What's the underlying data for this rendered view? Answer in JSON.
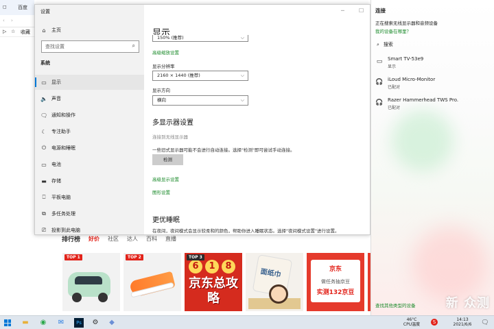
{
  "browser": {
    "tabs": [
      "百度"
    ],
    "favorites": "收藏",
    "rank_nav": {
      "title": "排行榜",
      "items": [
        "好价",
        "社区",
        "达人",
        "百科",
        "直播"
      ]
    },
    "products": [
      {
        "badge": "TOP 1"
      },
      {
        "badge": "TOP 2"
      },
      {
        "badge": "TOP 3",
        "digits": [
          "6",
          "1",
          "8"
        ],
        "promo": "京东总攻略"
      },
      {
        "tissue_text": "面纸巾"
      },
      {
        "logo": "京东",
        "line1": "做任务抽京豆",
        "line2": "实测132京豆"
      }
    ]
  },
  "settings": {
    "window_title": "设置",
    "home_label": "主页",
    "search_placeholder": "查找设置",
    "section": "系统",
    "nav_items": [
      {
        "icon": "display-icon",
        "glyph": "▭",
        "label": "显示"
      },
      {
        "icon": "sound-icon",
        "glyph": "🔈",
        "label": "声音"
      },
      {
        "icon": "notification-icon",
        "glyph": "🗨",
        "label": "通知和操作"
      },
      {
        "icon": "focus-assist-icon",
        "glyph": "☾",
        "label": "专注助手"
      },
      {
        "icon": "power-icon",
        "glyph": "⏻",
        "label": "电源和睡眠"
      },
      {
        "icon": "battery-icon",
        "glyph": "▭",
        "label": "电池"
      },
      {
        "icon": "storage-icon",
        "glyph": "▬",
        "label": "存储"
      },
      {
        "icon": "tablet-icon",
        "glyph": "⎕",
        "label": "平板电脑"
      },
      {
        "icon": "multitasking-icon",
        "glyph": "⧉",
        "label": "多任务处理"
      },
      {
        "icon": "projecting-icon",
        "glyph": "⎚",
        "label": "投影到此电脑"
      }
    ],
    "display": {
      "title": "显示",
      "scale_value": "150% (推荐)",
      "advanced_scaling_link": "高级缩放设置",
      "resolution_label": "显示分辨率",
      "resolution_value": "2160 × 1440 (推荐)",
      "orientation_label": "显示方向",
      "orientation_value": "横向",
      "multi_title": "多显示器设置",
      "connect_wireless": "连接到无线显示器",
      "detect_text": "一些旧式显示器可能不会进行自动连接。选择\"检测\"即可尝试手动连接。",
      "detect_button": "检测",
      "advanced_display_link": "高级显示设置",
      "graphics_link": "图形设置",
      "sleep_title": "更优睡眠",
      "sleep_text": "在夜间，夜间模式会显示较柔和的颜色，帮助你进入睡眠状态。选择\"夜间模式设置\"进行设置。"
    }
  },
  "connect": {
    "title": "连接",
    "searching": "正在搜索无线显示器和音频设备",
    "missing_link": "我的设备在哪里？",
    "search_label": "搜索",
    "devices": [
      {
        "icon": "monitor-icon",
        "glyph": "▭",
        "name": "Smart TV-53e9",
        "status": "显示"
      },
      {
        "icon": "headset-icon",
        "glyph": "🎧",
        "name": "iLoud Micro-Monitor",
        "status": "已配对"
      },
      {
        "icon": "headset-icon",
        "glyph": "🎧",
        "name": "Razer Hammerhead TWS Pro.",
        "status": "已配对"
      }
    ],
    "other_link": "查找其他类型的设备",
    "watermark": "新 众测"
  },
  "taskbar": {
    "temperature": "46°C",
    "cpu_label": "CPU温度",
    "time": "14:13",
    "date": "2021/6/6"
  }
}
